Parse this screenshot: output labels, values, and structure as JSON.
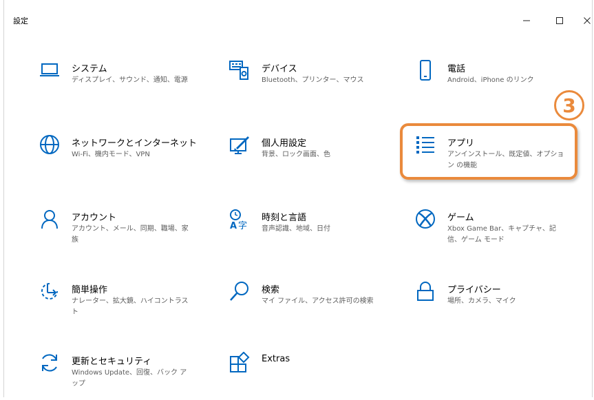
{
  "window": {
    "title": "設定"
  },
  "controls": {
    "minimize": "–",
    "maximize": "□",
    "close": "×"
  },
  "tiles": [
    {
      "id": "system",
      "label": "システム",
      "desc": "ディスプレイ、サウンド、通知、電源",
      "icon": "laptop-icon"
    },
    {
      "id": "devices",
      "label": "デバイス",
      "desc": "Bluetooth、プリンター、マウス",
      "icon": "keyboard-device-icon"
    },
    {
      "id": "phone",
      "label": "電話",
      "desc": "Android、iPhone のリンク",
      "icon": "phone-icon"
    },
    {
      "id": "network",
      "label": "ネットワークとインターネット",
      "desc": "Wi-Fi、機内モード、VPN",
      "icon": "globe-icon"
    },
    {
      "id": "personal",
      "label": "個人用設定",
      "desc": "背景、ロック画面、色",
      "icon": "paint-icon"
    },
    {
      "id": "apps",
      "label": "アプリ",
      "desc": "アンインストール、既定値、オプション の機能",
      "icon": "app-list-icon"
    },
    {
      "id": "accounts",
      "label": "アカウント",
      "desc": "アカウント、メール、同期、職場、家 族",
      "icon": "person-icon"
    },
    {
      "id": "time",
      "label": "時刻と言語",
      "desc": "音声認識、地域、日付",
      "icon": "time-language-icon"
    },
    {
      "id": "gaming",
      "label": "ゲーム",
      "desc": "Xbox Game Bar、キャプチャ、記 信、ゲーム モード",
      "icon": "xbox-icon"
    },
    {
      "id": "ease",
      "label": "簡単操作",
      "desc": "ナレーター、拡大鏡、ハイコントラスト",
      "icon": "ease-of-access-icon"
    },
    {
      "id": "search",
      "label": "検索",
      "desc": "マイ ファイル、アクセス許可の検索",
      "icon": "search-icon"
    },
    {
      "id": "privacy",
      "label": "プライバシー",
      "desc": "場所、カメラ、マイク",
      "icon": "lock-icon"
    },
    {
      "id": "update",
      "label": "更新とセキュリティ",
      "desc": "Windows Update、回復、バック アップ",
      "icon": "sync-icon"
    },
    {
      "id": "extras",
      "label": "Extras",
      "desc": "",
      "icon": "extras-icon"
    }
  ],
  "annotation": {
    "step": "3",
    "color": "#ea8a3c"
  },
  "colors": {
    "icon": "#0067c0",
    "text": "#000000",
    "desc": "#5d5d5d"
  }
}
